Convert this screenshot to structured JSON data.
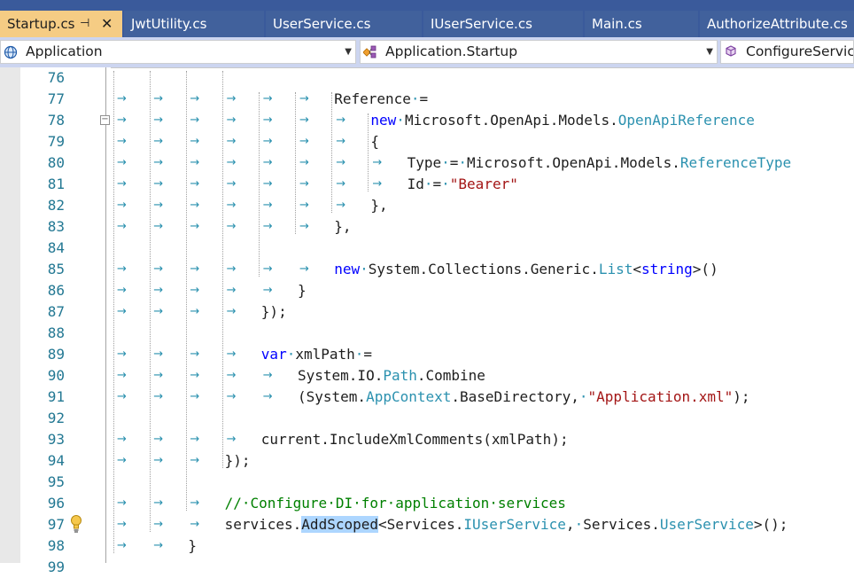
{
  "tabs": [
    {
      "label": "Startup.cs",
      "active": true
    },
    {
      "label": "JwtUtility.cs",
      "active": false
    },
    {
      "label": "UserService.cs",
      "active": false
    },
    {
      "label": "IUserService.cs",
      "active": false
    },
    {
      "label": "Main.cs",
      "active": false
    },
    {
      "label": "AuthorizeAttribute.cs",
      "active": false
    }
  ],
  "tab_pin_glyph": "⊣",
  "tab_close_glyph": "✕",
  "navigation": {
    "project": "Application",
    "type": "Application.Startup",
    "member": "ConfigureServices"
  },
  "icons": {
    "project": "globe-project-icon",
    "type": "class-icon",
    "member": "method-cube-icon",
    "lightbulb": "lightbulb-icon"
  },
  "colors": {
    "keyword": "#0000ff",
    "type": "#2b91af",
    "string": "#a31515",
    "comment": "#008000",
    "line_number": "#237893",
    "active_tab": "#f5cc84",
    "tab_bar": "#3a5a9b",
    "selection": "#add6ff"
  },
  "lines": [
    {
      "number": "76",
      "arrows": 0,
      "code": []
    },
    {
      "number": "77",
      "arrows": 6,
      "code": [
        [
          "",
          "Reference"
        ],
        [
          "ws",
          "·"
        ],
        [
          "",
          "="
        ]
      ]
    },
    {
      "number": "78",
      "arrows": 7,
      "code": [
        [
          "kw",
          "new"
        ],
        [
          "ws",
          "·"
        ],
        [
          "",
          "Microsoft.OpenApi.Models."
        ],
        [
          "ty",
          "OpenApiReference"
        ]
      ]
    },
    {
      "number": "79",
      "arrows": 7,
      "code": [
        [
          "",
          "{"
        ]
      ]
    },
    {
      "number": "80",
      "arrows": 8,
      "code": [
        [
          "",
          "Type"
        ],
        [
          "ws",
          "·"
        ],
        [
          "",
          "="
        ],
        [
          "ws",
          "·"
        ],
        [
          "",
          "Microsoft.OpenApi.Models."
        ],
        [
          "ty",
          "ReferenceType"
        ]
      ]
    },
    {
      "number": "81",
      "arrows": 8,
      "code": [
        [
          "",
          "Id"
        ],
        [
          "ws",
          "·"
        ],
        [
          "",
          "="
        ],
        [
          "ws",
          "·"
        ],
        [
          "str",
          "\"Bearer\""
        ]
      ]
    },
    {
      "number": "82",
      "arrows": 7,
      "code": [
        [
          "",
          "},"
        ]
      ]
    },
    {
      "number": "83",
      "arrows": 6,
      "code": [
        [
          "",
          "},"
        ]
      ]
    },
    {
      "number": "84",
      "arrows": 0,
      "code": []
    },
    {
      "number": "85",
      "arrows": 6,
      "code": [
        [
          "kw",
          "new"
        ],
        [
          "ws",
          "·"
        ],
        [
          "",
          "System.Collections.Generic."
        ],
        [
          "ty",
          "List"
        ],
        [
          "",
          "<"
        ],
        [
          "kw",
          "string"
        ],
        [
          "",
          ">()"
        ]
      ]
    },
    {
      "number": "86",
      "arrows": 5,
      "code": [
        [
          "",
          "}"
        ]
      ]
    },
    {
      "number": "87",
      "arrows": 4,
      "code": [
        [
          "",
          "});"
        ]
      ]
    },
    {
      "number": "88",
      "arrows": 0,
      "code": []
    },
    {
      "number": "89",
      "arrows": 4,
      "code": [
        [
          "kw",
          "var"
        ],
        [
          "ws",
          "·"
        ],
        [
          "",
          "xmlPath"
        ],
        [
          "ws",
          "·"
        ],
        [
          "",
          "="
        ]
      ]
    },
    {
      "number": "90",
      "arrows": 5,
      "code": [
        [
          "",
          "System.IO."
        ],
        [
          "ty",
          "Path"
        ],
        [
          "",
          ".Combine"
        ]
      ]
    },
    {
      "number": "91",
      "arrows": 5,
      "code": [
        [
          "",
          "(System."
        ],
        [
          "ty",
          "AppContext"
        ],
        [
          "",
          ".BaseDirectory,"
        ],
        [
          "ws",
          "·"
        ],
        [
          "str",
          "\"Application.xml\""
        ],
        [
          "",
          ");"
        ]
      ]
    },
    {
      "number": "92",
      "arrows": 0,
      "code": []
    },
    {
      "number": "93",
      "arrows": 4,
      "code": [
        [
          "",
          "current.IncludeXmlComments(xmlPath);"
        ]
      ]
    },
    {
      "number": "94",
      "arrows": 3,
      "code": [
        [
          "",
          "});"
        ]
      ]
    },
    {
      "number": "95",
      "arrows": 0,
      "code": []
    },
    {
      "number": "96",
      "arrows": 3,
      "code": [
        [
          "cm",
          "//·Configure·DI·for·application·services"
        ]
      ]
    },
    {
      "number": "97",
      "arrows": 3,
      "code": [
        [
          "",
          "services."
        ],
        [
          "hl",
          "AddScoped"
        ],
        [
          "",
          "<Services."
        ],
        [
          "ty",
          "IUserService"
        ],
        [
          "",
          ","
        ],
        [
          "ws",
          "·"
        ],
        [
          "",
          "Services."
        ],
        [
          "ty",
          "UserService"
        ],
        [
          "",
          ">();"
        ]
      ]
    },
    {
      "number": "98",
      "arrows": 2,
      "code": [
        [
          "",
          "}"
        ]
      ]
    },
    {
      "number": "99",
      "arrows": 0,
      "code": []
    }
  ]
}
